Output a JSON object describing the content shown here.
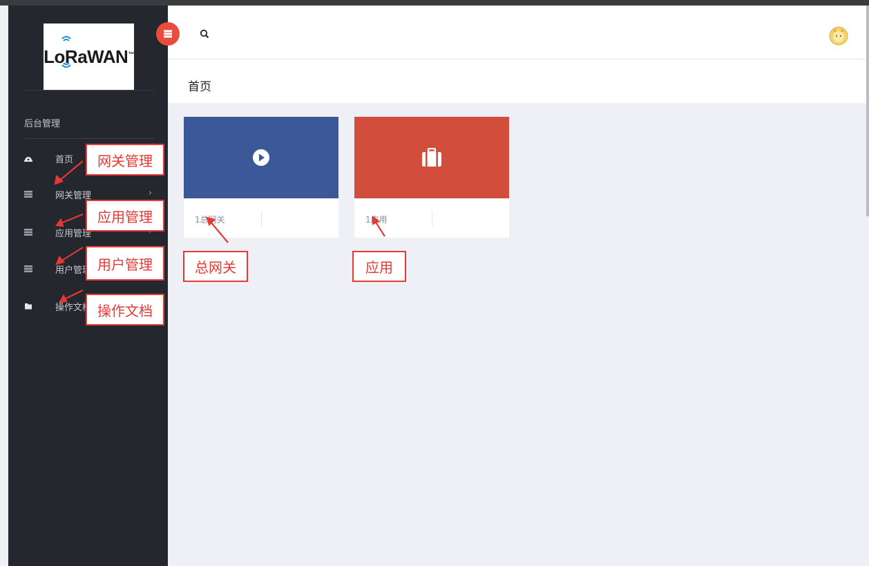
{
  "logo": {
    "text": "LoRaWAN",
    "tm": "™"
  },
  "sidebar": {
    "section_title": "后台管理",
    "items": [
      {
        "label": "首页",
        "icon": "dashboard-icon"
      },
      {
        "label": "网关管理",
        "icon": "server-icon",
        "chevron": "›"
      },
      {
        "label": "应用管理",
        "icon": "server-icon",
        "chevron": "›"
      },
      {
        "label": "用户管理",
        "icon": "server-icon",
        "chevron": "›"
      },
      {
        "label": "操作文档",
        "icon": "folder-icon"
      }
    ]
  },
  "header": {
    "search_icon": "search-icon",
    "avatar_icon": "avatar-icon"
  },
  "page": {
    "title": "首页"
  },
  "cards": [
    {
      "count_label": "1总网关",
      "color": "#3b5998",
      "icon": "play-circle-icon"
    },
    {
      "count_label": "1应用",
      "color": "#d24d3b",
      "icon": "briefcase-icon"
    }
  ],
  "annotations": {
    "gateway_mgmt": "网关管理",
    "app_mgmt": "应用管理",
    "user_mgmt": "用户管理",
    "docs": "操作文档",
    "total_gateway": "总网关",
    "app": "应用"
  },
  "colors": {
    "sidebar_bg": "#24272d",
    "accent_red": "#e84c3d",
    "annotation_red": "#e53935",
    "content_bg": "#eff0f6"
  }
}
